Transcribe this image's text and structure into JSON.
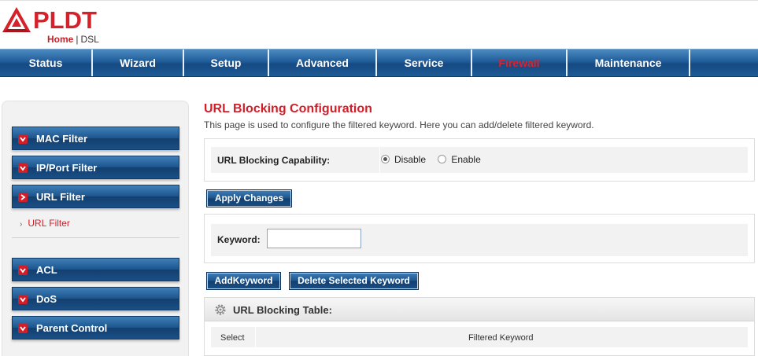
{
  "brand": {
    "name": "PLDT",
    "sub_home": "Home",
    "sub_sep": "|",
    "sub_dsl": "DSL",
    "color": "#d6202a"
  },
  "nav": {
    "items": [
      {
        "label": "Status"
      },
      {
        "label": "Wizard"
      },
      {
        "label": "Setup"
      },
      {
        "label": "Advanced"
      },
      {
        "label": "Service"
      },
      {
        "label": "Firewall",
        "active": true
      },
      {
        "label": "Maintenance"
      }
    ]
  },
  "sidebar": {
    "items": [
      {
        "label": "MAC Filter",
        "icon": "chevron-down-icon"
      },
      {
        "label": "IP/Port Filter",
        "icon": "chevron-down-icon"
      },
      {
        "label": "URL Filter",
        "icon": "chevron-right-icon",
        "expanded": true
      },
      {
        "label": "ACL",
        "icon": "chevron-down-icon"
      },
      {
        "label": "DoS",
        "icon": "chevron-down-icon"
      },
      {
        "label": "Parent Control",
        "icon": "chevron-down-icon"
      }
    ],
    "submenu": {
      "label": "URL Filter",
      "bullet": "›"
    }
  },
  "main": {
    "title": "URL Blocking Configuration",
    "description": "This page is used to configure the filtered keyword. Here you can add/delete filtered keyword.",
    "capability": {
      "label": "URL Blocking Capability:",
      "options": [
        {
          "label": "Disable",
          "checked": true
        },
        {
          "label": "Enable",
          "checked": false
        }
      ]
    },
    "apply_label": "Apply Changes",
    "keyword": {
      "label": "Keyword:",
      "value": "",
      "placeholder": ""
    },
    "add_label": "AddKeyword",
    "delete_label": "Delete Selected Keyword",
    "table": {
      "title": "URL Blocking Table:",
      "columns": [
        "Select",
        "Filtered Keyword"
      ]
    }
  },
  "colors": {
    "accent_red": "#d21e28",
    "nav_blue": "#1f5c99"
  }
}
